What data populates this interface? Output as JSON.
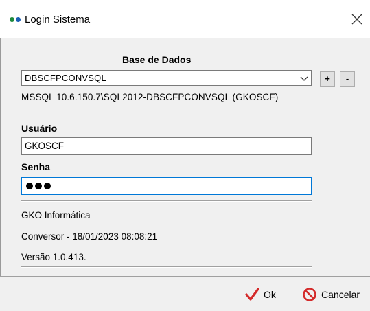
{
  "window": {
    "title": "Login Sistema"
  },
  "database": {
    "label": "Base de Dados",
    "selected": "DBSCFPCONVSQL",
    "add_label": "+",
    "remove_label": "-",
    "connection": "MSSQL 10.6.150.7\\SQL2012-DBSCFPCONVSQL (GKOSCF)"
  },
  "user": {
    "label": "Usuário",
    "value": "GKOSCF"
  },
  "password": {
    "label": "Senha",
    "masked_length": 3
  },
  "info": {
    "company": "GKO Informática",
    "build": "Conversor - 18/01/2023 08:08:21",
    "version": "Versão 1.0.413."
  },
  "actions": {
    "ok_label": "Ok",
    "cancel_label": "Cancelar"
  },
  "colors": {
    "ok_check": "#d42a2a",
    "cancel_icon": "#d42a2a",
    "focus_border": "#0078d7",
    "icon_green": "#1e8a3c",
    "icon_blue": "#1a5fb4"
  },
  "icons": {
    "app": "app-dots-icon",
    "close": "close-icon",
    "dropdown": "chevron-down-icon",
    "ok": "checkmark-icon",
    "cancel": "prohibited-icon"
  }
}
